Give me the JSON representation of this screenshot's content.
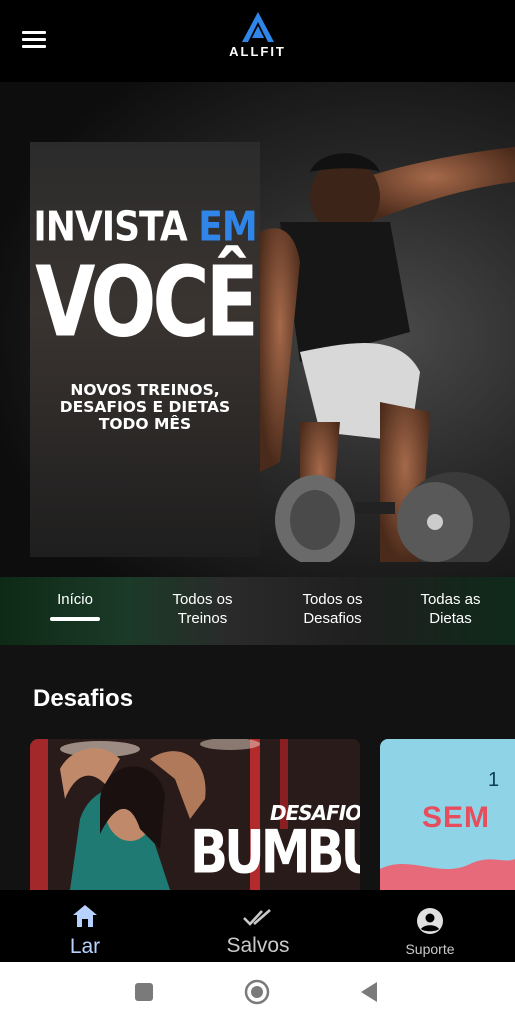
{
  "header": {
    "brand": "ALLFIT",
    "menu_icon": "hamburger-menu-icon"
  },
  "hero": {
    "line1_a": "INVISTA",
    "line1_b": "EM",
    "line2": "VOCÊ",
    "line3": "NOVOS TREINOS,",
    "line4": "DESAFIOS E DIETAS",
    "line5": "TODO MÊS",
    "accent_color": "#2f86e8"
  },
  "tabs": [
    {
      "line1": "Início",
      "line2": "",
      "active": true
    },
    {
      "line1": "Todos os",
      "line2": "Treinos",
      "active": false
    },
    {
      "line1": "Todos os",
      "line2": "Desafios",
      "active": false
    },
    {
      "line1": "Todas as",
      "line2": "Dietas",
      "active": false
    }
  ],
  "section": {
    "title": "Desafios",
    "cards": [
      {
        "title1": "DESAFIO",
        "title2": "BUMBUM"
      },
      {
        "num": "1",
        "title": "SEM"
      }
    ]
  },
  "bottom_nav": [
    {
      "label": "Lar",
      "icon": "home-icon",
      "active": true
    },
    {
      "label": "Salvos",
      "icon": "double-check-icon",
      "active": false
    },
    {
      "label": "Suporte",
      "icon": "account-circle-icon",
      "active": false
    }
  ],
  "system_nav": {
    "recents": "square-recents-icon",
    "home": "circle-home-icon",
    "back": "triangle-back-icon"
  }
}
